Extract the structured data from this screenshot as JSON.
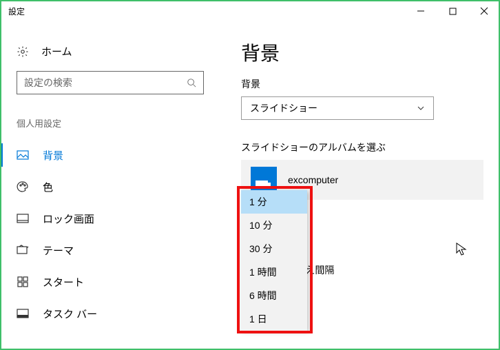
{
  "window": {
    "title": "設定"
  },
  "sidebar": {
    "homeLabel": "ホーム",
    "searchPlaceholder": "設定の検索",
    "sectionTitle": "個人用設定",
    "items": [
      {
        "label": "背景",
        "icon": "image-icon",
        "selected": true
      },
      {
        "label": "色",
        "icon": "palette-icon"
      },
      {
        "label": "ロック画面",
        "icon": "lockscreen-icon"
      },
      {
        "label": "テーマ",
        "icon": "theme-icon"
      },
      {
        "label": "スタート",
        "icon": "start-icon"
      },
      {
        "label": "タスク バー",
        "icon": "taskbar-icon"
      }
    ]
  },
  "main": {
    "heading": "背景",
    "backgroundLabel": "背景",
    "backgroundValue": "スライドショー",
    "albumLabel": "スライドショーのアルバムを選ぶ",
    "albumName": "excomputer",
    "intervalLabelFragment": "え間隔"
  },
  "dropdown": {
    "options": [
      "1 分",
      "10 分",
      "30 分",
      "1 時間",
      "6 時間",
      "1 日"
    ],
    "selectedIndex": 0
  }
}
